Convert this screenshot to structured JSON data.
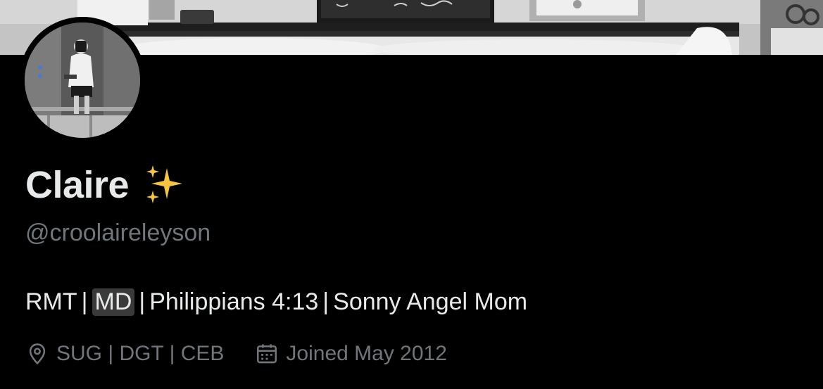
{
  "profile": {
    "display_name": "Claire",
    "display_emoji": "sparkles-icon",
    "handle": "@croolaireleyson",
    "bio": {
      "part1": "RMT",
      "sep": "|",
      "part2": "MD",
      "part3": "Philippians 4:13",
      "part4": "Sonny Angel Mom"
    },
    "location": "SUG | DGT | CEB",
    "joined": "Joined May 2012"
  },
  "icons": {
    "location": "location-pin-icon",
    "joined": "calendar-icon"
  },
  "colors": {
    "background": "#000000",
    "primary_text": "#e7e9ea",
    "secondary_text": "#71767b",
    "sparkle": "#f5c542"
  }
}
